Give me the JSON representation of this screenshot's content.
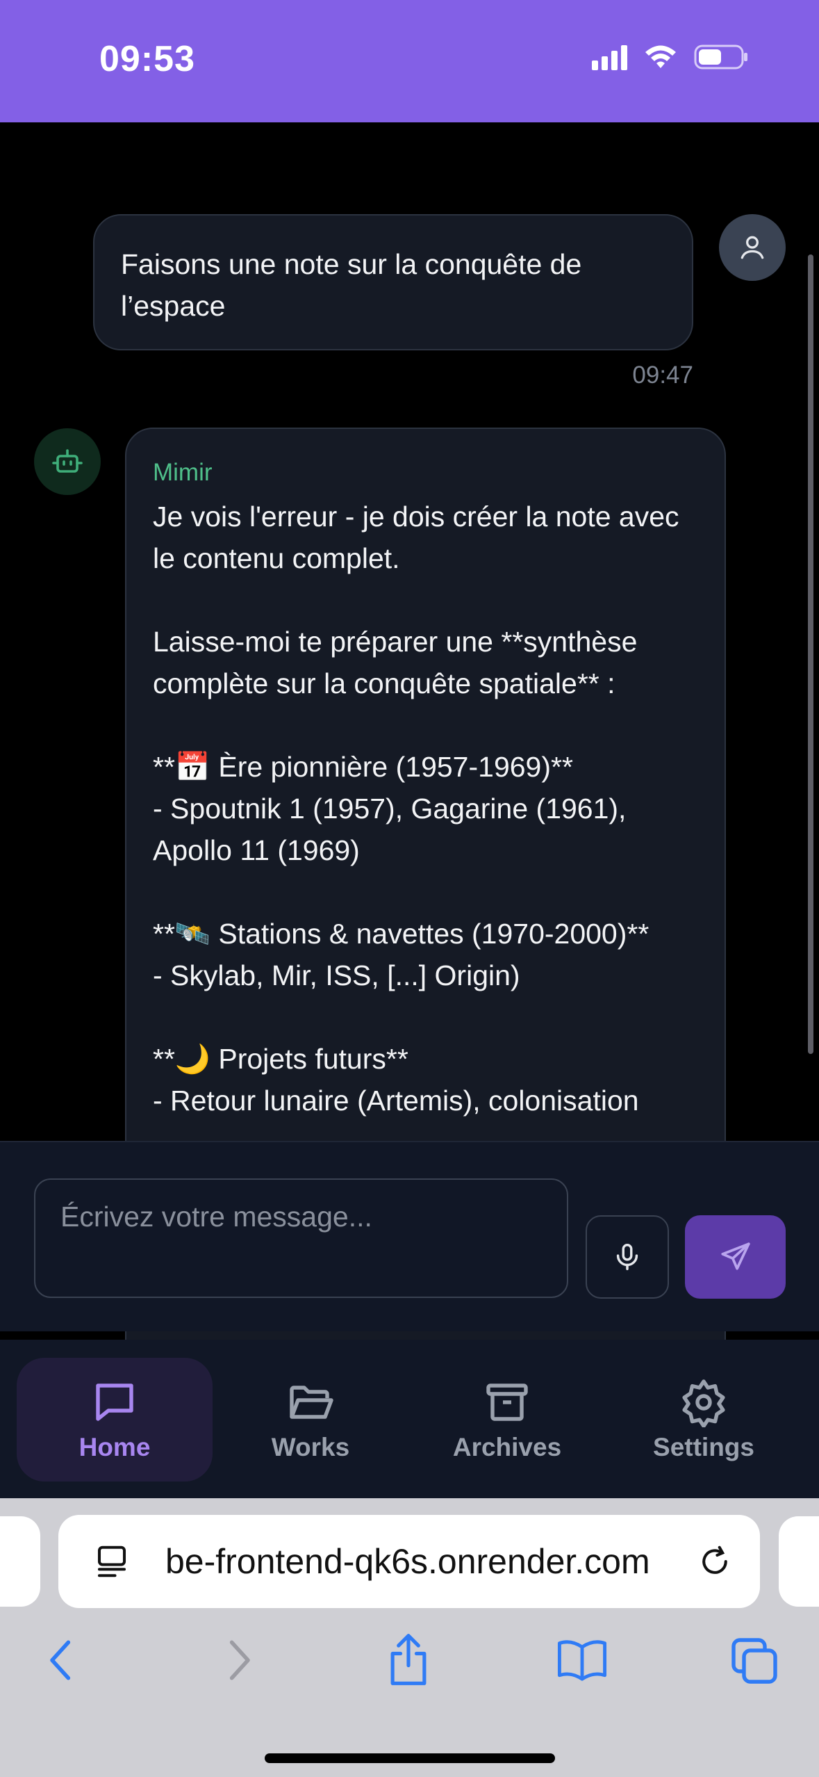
{
  "status_bar": {
    "time": "09:53",
    "icons": [
      "signal-icon",
      "wifi-icon",
      "battery-icon"
    ],
    "background": "#8360e6"
  },
  "messages": {
    "user": {
      "text": "Faisons une note sur la conquête de l’espace",
      "time": "09:47"
    },
    "bot": {
      "name": "Mimir",
      "text": "Je vois l'erreur - je dois créer la note avec le contenu complet.\n\nLaisse-moi te préparer une **synthèse complète sur la conquête spatiale** :\n\n**📅 Ère pionnière (1957-1969)**\n- Spoutnik 1 (1957), Gagarine (1961), Apollo 11 (1969)\n\n**🛰️ Stations & navettes (1970-2000)**\n- Skylab, Mir, ISS, [...] Origin)\n\n**🌙 Projets futurs**\n- Retour lunaire (Artemis), colonisation"
    }
  },
  "composer": {
    "placeholder": "Écrivez votre message...",
    "mic_icon": "microphone-icon",
    "send_icon": "send-icon"
  },
  "nav": {
    "items": [
      {
        "label": "Home",
        "icon": "chat-bubble-icon",
        "active": true
      },
      {
        "label": "Works",
        "icon": "folder-open-icon",
        "active": false
      },
      {
        "label": "Archives",
        "icon": "archive-box-icon",
        "active": false
      },
      {
        "label": "Settings",
        "icon": "gear-icon",
        "active": false
      }
    ],
    "accent": "#a886f0"
  },
  "browser": {
    "url": "be-frontend-qk6s.onrender.com"
  }
}
